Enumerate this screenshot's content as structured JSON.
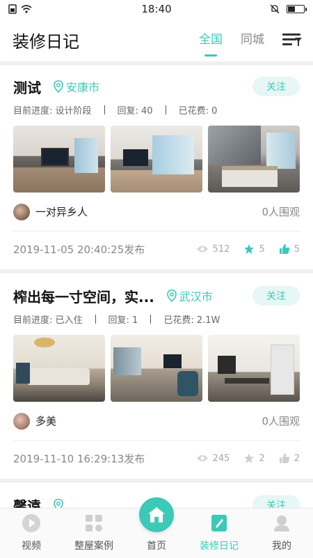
{
  "status": {
    "time": "18:40"
  },
  "header": {
    "title": "装修日记",
    "tabs": [
      {
        "label": "全国",
        "active": true
      },
      {
        "label": "同城",
        "active": false
      }
    ]
  },
  "cards": [
    {
      "title": "测试",
      "location": "安康市",
      "follow_label": "关注",
      "progress": "目前进度: 设计阶段",
      "replies": "回复:  40",
      "spent": "已花费:  0",
      "user": "一对异乡人",
      "viewers": "0人围观",
      "published": "2019-11-05 20:40:25发布",
      "views": "512",
      "stars": "5",
      "likes": "5"
    },
    {
      "title": "榨出每一寸空间，实...",
      "location": "武汉市",
      "follow_label": "关注",
      "progress": "目前进度: 已入住",
      "replies": "回复:  1",
      "spent": "已花费:  2.1W",
      "user": "多美",
      "viewers": "0人围观",
      "published": "2019-11-10 16:29:13发布",
      "views": "245",
      "stars": "2",
      "likes": "2"
    },
    {
      "title": "馨遠",
      "follow_label": "关注"
    }
  ],
  "nav": [
    {
      "label": "视频",
      "icon": "play-icon"
    },
    {
      "label": "整屋案例",
      "icon": "grid-icon"
    },
    {
      "label": "首页",
      "icon": "home-icon"
    },
    {
      "label": "装修日记",
      "icon": "diary-icon",
      "active": true
    },
    {
      "label": "我的",
      "icon": "user-icon"
    }
  ],
  "colors": {
    "accent": "#3cc9b8",
    "muted": "#888888"
  }
}
